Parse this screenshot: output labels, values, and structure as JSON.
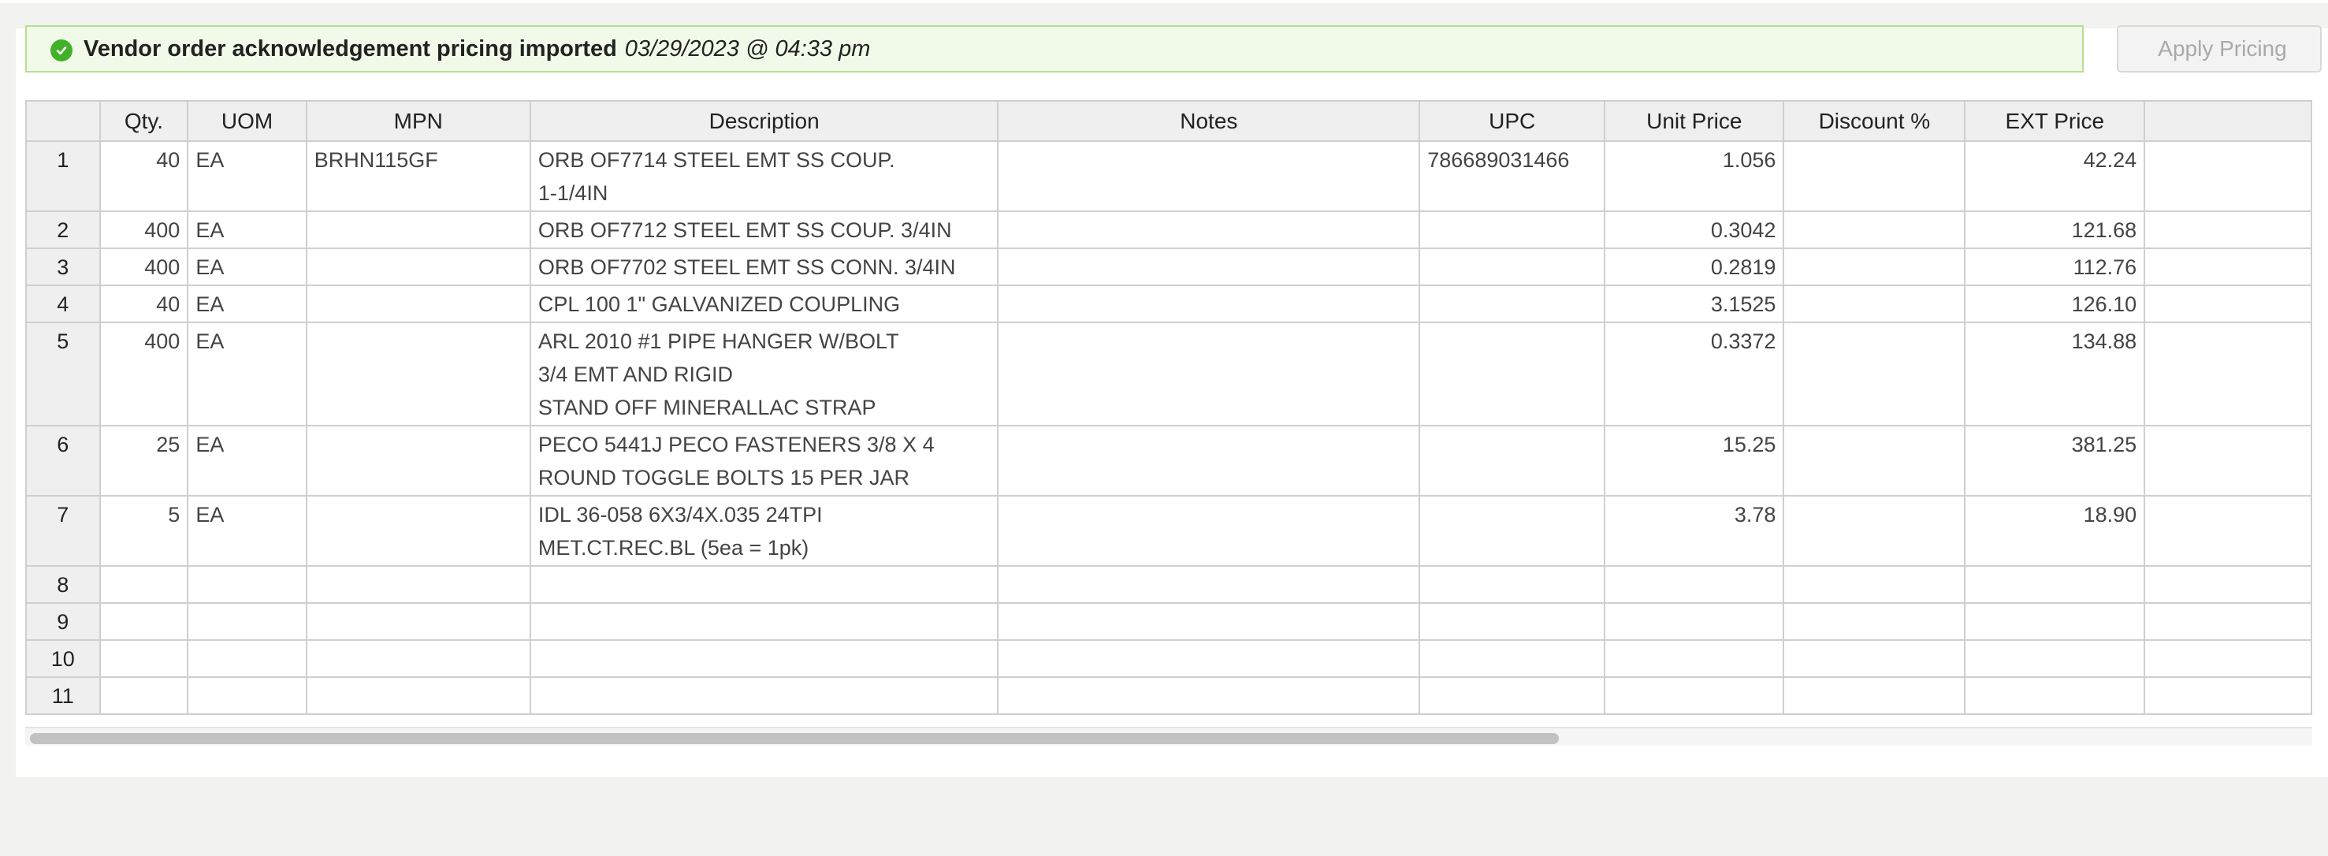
{
  "banner": {
    "message": "Vendor order acknowledgement pricing imported",
    "date": "03/29/2023 @ 04:33 pm",
    "icon": "check-circle-icon",
    "success_color": "#43b02a"
  },
  "apply_button": {
    "label": "Apply Pricing"
  },
  "table": {
    "columns": {
      "rownum": "",
      "qty": "Qty.",
      "uom": "UOM",
      "mpn": "MPN",
      "description": "Description",
      "notes": "Notes",
      "upc": "UPC",
      "unit_price": "Unit Price",
      "discount": "Discount %",
      "ext_price": "EXT Price"
    },
    "rows": [
      {
        "n": "1",
        "qty": "40",
        "uom": "EA",
        "mpn": "BRHN115GF",
        "desc": [
          "ORB OF7714 STEEL EMT SS COUP.",
          "1-1/4IN"
        ],
        "notes": "",
        "upc": "786689031466",
        "unit": "1.056",
        "disc": "",
        "ext": "42.24"
      },
      {
        "n": "2",
        "qty": "400",
        "uom": "EA",
        "mpn": "",
        "desc": [
          "ORB OF7712 STEEL EMT SS COUP. 3/4IN"
        ],
        "notes": "",
        "upc": "",
        "unit": "0.3042",
        "disc": "",
        "ext": "121.68"
      },
      {
        "n": "3",
        "qty": "400",
        "uom": "EA",
        "mpn": "",
        "desc": [
          "ORB OF7702 STEEL EMT SS CONN. 3/4IN"
        ],
        "notes": "",
        "upc": "",
        "unit": "0.2819",
        "disc": "",
        "ext": "112.76"
      },
      {
        "n": "4",
        "qty": "40",
        "uom": "EA",
        "mpn": "",
        "desc": [
          "CPL 100 1\" GALVANIZED COUPLING"
        ],
        "notes": "",
        "upc": "",
        "unit": "3.1525",
        "disc": "",
        "ext": "126.10"
      },
      {
        "n": "5",
        "qty": "400",
        "uom": "EA",
        "mpn": "",
        "desc": [
          "ARL 2010 #1 PIPE HANGER W/BOLT",
          "3/4 EMT AND RIGID",
          "STAND OFF MINERALLAC STRAP"
        ],
        "notes": "",
        "upc": "",
        "unit": "0.3372",
        "disc": "",
        "ext": "134.88"
      },
      {
        "n": "6",
        "qty": "25",
        "uom": "EA",
        "mpn": "",
        "desc": [
          "PECO 5441J PECO FASTENERS 3/8 X 4",
          "ROUND TOGGLE BOLTS 15 PER JAR"
        ],
        "notes": "",
        "upc": "",
        "unit": "15.25",
        "disc": "",
        "ext": "381.25"
      },
      {
        "n": "7",
        "qty": "5",
        "uom": "EA",
        "mpn": "",
        "desc": [
          "IDL 36-058 6X3/4X.035 24TPI",
          "MET.CT.REC.BL (5ea = 1pk)"
        ],
        "notes": "",
        "upc": "",
        "unit": "3.78",
        "disc": "",
        "ext": "18.90"
      },
      {
        "n": "8",
        "qty": "",
        "uom": "",
        "mpn": "",
        "desc": [
          ""
        ],
        "notes": "",
        "upc": "",
        "unit": "",
        "disc": "",
        "ext": ""
      },
      {
        "n": "9",
        "qty": "",
        "uom": "",
        "mpn": "",
        "desc": [
          ""
        ],
        "notes": "",
        "upc": "",
        "unit": "",
        "disc": "",
        "ext": ""
      },
      {
        "n": "10",
        "qty": "",
        "uom": "",
        "mpn": "",
        "desc": [
          ""
        ],
        "notes": "",
        "upc": "",
        "unit": "",
        "disc": "",
        "ext": ""
      },
      {
        "n": "11",
        "qty": "",
        "uom": "",
        "mpn": "",
        "desc": [
          ""
        ],
        "notes": "",
        "upc": "",
        "unit": "",
        "disc": "",
        "ext": ""
      }
    ]
  }
}
